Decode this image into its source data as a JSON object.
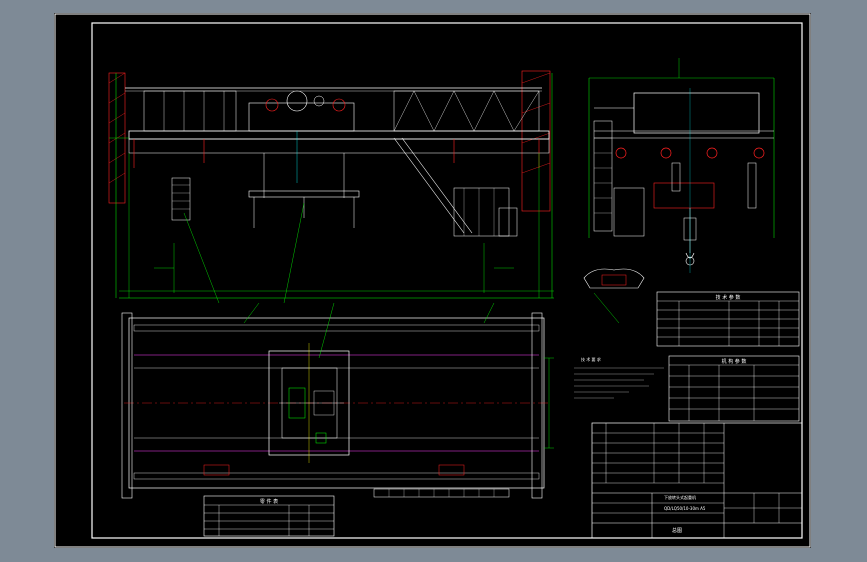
{
  "drawing": {
    "title_block": {
      "name": "下放转头式起重机",
      "spec": "QD/LQ50/10-30m A5",
      "drawing_type": "总图"
    },
    "tech_requirements": {
      "heading": "技 术 要 求"
    },
    "params_table": {
      "title": "技 术 参 数"
    },
    "mech_table": {
      "title": "机 构 参 数"
    },
    "parts_table": {
      "title": "零 件 表"
    }
  },
  "colors": {
    "frame": "#ffffff",
    "line_green": "#00ff00",
    "line_white": "#ffffff",
    "line_red": "#ff2020",
    "line_cyan": "#00ffff",
    "line_yellow": "#ffff00",
    "line_magenta": "#ff40ff",
    "background": "#000000",
    "page_bg": "#7e8a96"
  }
}
